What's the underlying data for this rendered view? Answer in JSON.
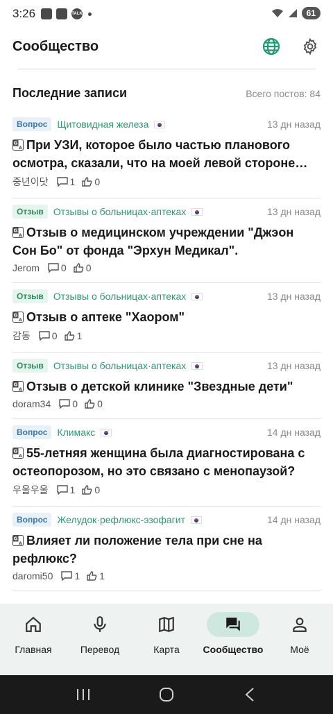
{
  "status": {
    "time": "3:26",
    "battery": "61"
  },
  "header": {
    "title": "Сообщество"
  },
  "section": {
    "title": "Последние записи",
    "total": "Всего постов: 84"
  },
  "posts": [
    {
      "badge": "Вопрос",
      "badge_type": "question",
      "category": "Щитовидная железа",
      "time": "13 дн назад",
      "title": "При УЗИ, которое было частью планового осмотра, сказали, что на моей левой стороне щитовидной железы…",
      "author": "중년이닷",
      "comments": "1",
      "likes": "0"
    },
    {
      "badge": "Отзыв",
      "badge_type": "review",
      "category": "Отзывы о больницах·аптеках",
      "time": "13 дн назад",
      "title": "Отзыв о медицинском учреждении \"Джэон Сон Бо\" от фонда \"Эрхун Медикал\".",
      "author": "Jerom",
      "comments": "0",
      "likes": "0"
    },
    {
      "badge": "Отзыв",
      "badge_type": "review",
      "category": "Отзывы о больницах·аптеках",
      "time": "13 дн назад",
      "title": "Отзыв о аптеке \"Хаором\"",
      "author": "감동",
      "comments": "0",
      "likes": "1"
    },
    {
      "badge": "Отзыв",
      "badge_type": "review",
      "category": "Отзывы о больницах·аптеках",
      "time": "13 дн назад",
      "title": "Отзыв о детской клинике \"Звездные дети\"",
      "author": "doram34",
      "comments": "0",
      "likes": "0"
    },
    {
      "badge": "Вопрос",
      "badge_type": "question",
      "category": "Климакс",
      "time": "14 дн назад",
      "title": "55-летняя женщина была диагностирована с остеопорозом, но это связано с менопаузой?",
      "author": "우울우울",
      "comments": "1",
      "likes": "0"
    },
    {
      "badge": "Вопрос",
      "badge_type": "question",
      "category": "Желудок·рефлюкс-эзофагит",
      "time": "14 дн назад",
      "title": "Влияет ли положение тела при сне на рефлюкс?",
      "author": "daromi50",
      "comments": "1",
      "likes": "1"
    }
  ],
  "nav": [
    {
      "label": "Главная",
      "icon": "home-icon"
    },
    {
      "label": "Перевод",
      "icon": "mic-icon"
    },
    {
      "label": "Карта",
      "icon": "map-icon"
    },
    {
      "label": "Сообщество",
      "icon": "forum-icon",
      "active": true
    },
    {
      "label": "Моё",
      "icon": "person-icon"
    }
  ],
  "colors": {
    "accent": "#2b9a6e",
    "question": "#3b76a8",
    "nav_bg": "#eef3f1",
    "nav_active": "#cfe8df"
  }
}
